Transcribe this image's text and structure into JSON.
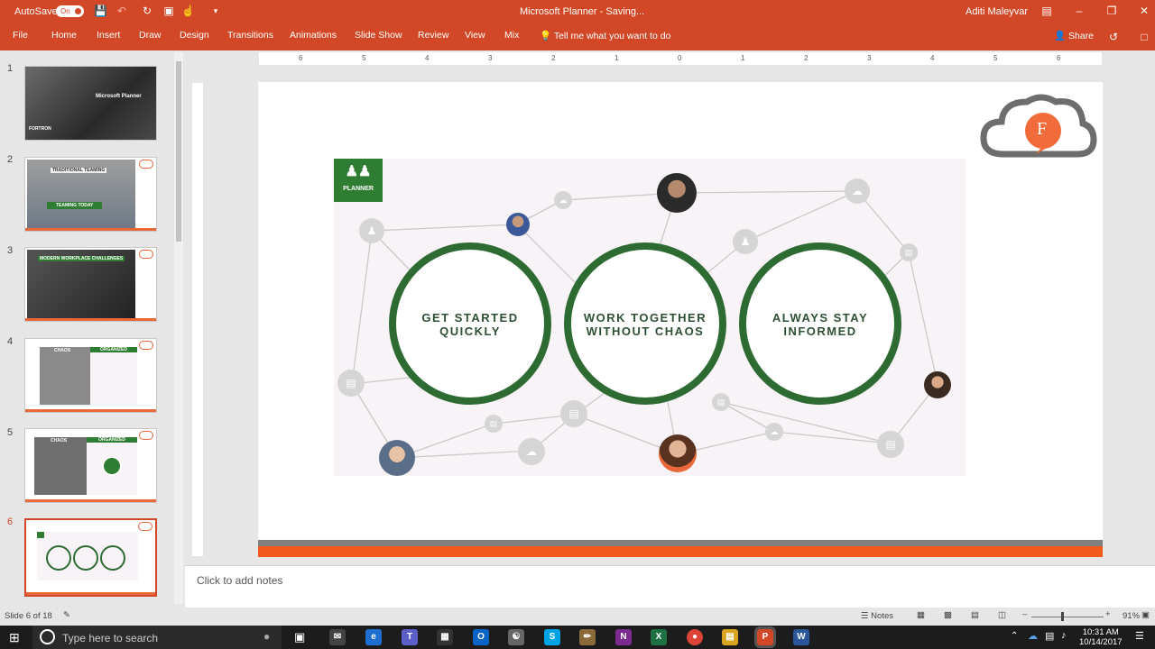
{
  "titlebar": {
    "autosave_label": "AutoSave",
    "autosave_state": "On",
    "doc_title": "Microsoft Planner  -  Saving...",
    "user_name": "Aditi Maleyvar"
  },
  "ribbon": {
    "tabs": [
      "File",
      "Home",
      "Insert",
      "Draw",
      "Design",
      "Transitions",
      "Animations",
      "Slide Show",
      "Review",
      "View",
      "Mix"
    ],
    "tell_me": "Tell me what you want to do",
    "share": "Share"
  },
  "thumbnails": {
    "numbers": [
      "1",
      "2",
      "3",
      "4",
      "5",
      "6"
    ],
    "t1_title": "Microsoft Planner",
    "t1_brand": "FORTRON",
    "t2_top": "TRADITIONAL TEAMING",
    "t2_bottom": "TEAMING TODAY",
    "t3_title": "MODERN WORKPLACE CHALLENGES",
    "t4_left": "CHAOS",
    "t4_right": "ORGANIZED",
    "t5_left": "CHAOS",
    "t5_right": "ORGANIZED"
  },
  "ruler": {
    "labels": [
      "6",
      "5",
      "4",
      "3",
      "2",
      "1",
      "0",
      "1",
      "2",
      "3",
      "4",
      "5",
      "6"
    ]
  },
  "slide": {
    "planner_label": "PLANNER",
    "logo_letter": "F",
    "rings": [
      {
        "line1": "GET STARTED",
        "line2": "QUICKLY"
      },
      {
        "line1": "WORK TOGETHER",
        "line2": "WITHOUT CHAOS"
      },
      {
        "line1": "ALWAYS STAY",
        "line2": "INFORMED"
      }
    ],
    "ring_color": "#2e6b33",
    "accent_orange": "#f05a1a"
  },
  "notes": {
    "placeholder": "Click to add notes"
  },
  "status": {
    "slide_info": "Slide 6 of 18",
    "notes_label": "Notes",
    "zoom": "91%"
  },
  "taskbar": {
    "search_placeholder": "Type here to search",
    "time": "10:31 AM",
    "date": "10/14/2017"
  }
}
